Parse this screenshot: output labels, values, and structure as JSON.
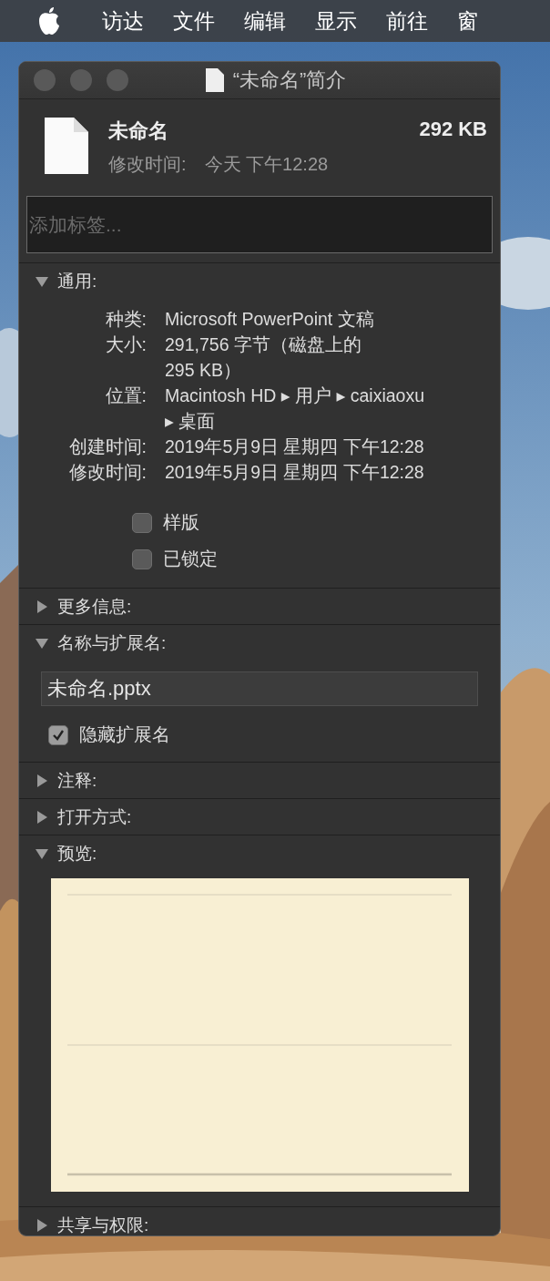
{
  "menu_bar": {
    "items": [
      "访达",
      "文件",
      "编辑",
      "显示",
      "前往",
      "窗"
    ]
  },
  "window": {
    "title": "“未命名”简介"
  },
  "file": {
    "name": "未命名",
    "size": "292 KB",
    "modified_label": "修改时间:",
    "modified_value": "今天 下午12:28"
  },
  "tags": {
    "placeholder": "添加标签..."
  },
  "sections": [
    {
      "kind": "general",
      "title": "通用:",
      "expanded": true,
      "rows": [
        {
          "label": "种类:",
          "lines": [
            "Microsoft PowerPoint 文稿"
          ]
        },
        {
          "label": "大小:",
          "lines": [
            "291,756 字节（磁盘上的",
            "295 KB）"
          ]
        },
        {
          "label": "位置:",
          "lines": [
            "Macintosh HD ▸ 用户 ▸ caixiaoxu",
            "▸ 桌面"
          ]
        },
        {
          "label": "创建时间:",
          "lines": [
            "2019年5月9日 星期四 下午12:28"
          ]
        },
        {
          "label": "修改时间:",
          "lines": [
            "2019年5月9日 星期四 下午12:28"
          ]
        }
      ],
      "checkboxes": [
        {
          "label": "样版",
          "checked": false
        },
        {
          "label": "已锁定",
          "checked": false
        }
      ]
    },
    {
      "kind": "more",
      "title": "更多信息:",
      "expanded": false
    },
    {
      "kind": "name",
      "title": "名称与扩展名:",
      "expanded": true,
      "value": "未命名.pptx",
      "checkboxes": [
        {
          "label": "隐藏扩展名",
          "checked": true
        }
      ]
    },
    {
      "kind": "comments",
      "title": "注释:",
      "expanded": false
    },
    {
      "kind": "open_with",
      "title": "打开方式:",
      "expanded": false
    },
    {
      "kind": "preview",
      "title": "预览:",
      "expanded": true
    },
    {
      "kind": "sharing",
      "title": "共享与权限:",
      "expanded": false
    }
  ]
}
